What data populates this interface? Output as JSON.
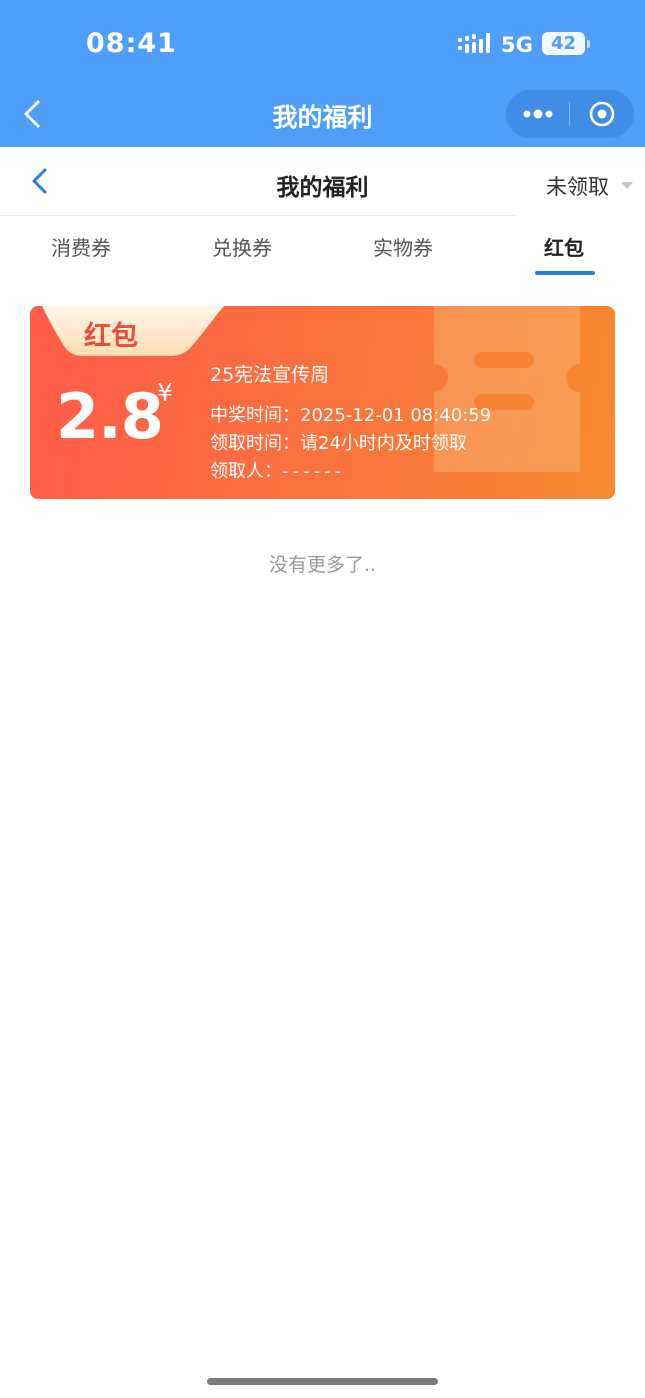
{
  "status_bar": {
    "time": "08:41",
    "network": "5G",
    "battery": "42"
  },
  "mini_program": {
    "title": "我的福利"
  },
  "page": {
    "title": "我的福利",
    "filter": "未领取"
  },
  "tabs": [
    {
      "label": "消费券"
    },
    {
      "label": "兑换券"
    },
    {
      "label": "实物券"
    },
    {
      "label": "红包",
      "active": true
    }
  ],
  "red_packet": {
    "tag": "红包",
    "amount": "2.8",
    "currency": "¥",
    "title": "25宪法宣传周",
    "win_time_label": "中奖时间：",
    "win_time": "2025-12-01 08:40:59",
    "claim_time_label": "领取时间：",
    "claim_time": "请24小时内及时领取",
    "claimer_label": "领取人：",
    "claimer": "------"
  },
  "list_end": "没有更多了..",
  "colors": {
    "primary_blue": "#4f9ffa",
    "tab_active": "#2a7bdc",
    "card_start": "#ff5b4a",
    "card_end": "#f78a2e"
  }
}
